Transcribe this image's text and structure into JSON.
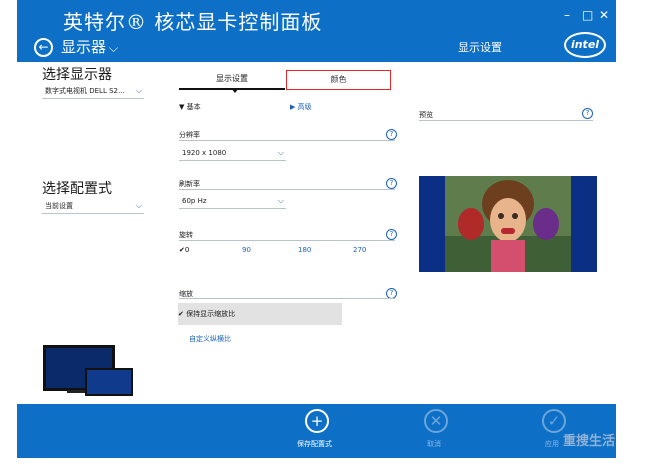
{
  "app": {
    "title": "英特尔® 核芯显卡控制面板",
    "section": "显示器",
    "breadcrumb": "显示设置",
    "logo": "intel",
    "window_controls": [
      "–",
      "□",
      "✕"
    ]
  },
  "left": {
    "select_display_heading": "选择显示器",
    "display_value": "数字式电视机 DELL S2…",
    "select_profile_heading": "选择配置式",
    "profile_value": "当前设置"
  },
  "tabs": [
    "显示设置",
    "颜色"
  ],
  "toggles": {
    "basic": "基本",
    "advanced": "高级"
  },
  "fields": {
    "resolution_label": "分辨率",
    "resolution_value": "1920 x 1080",
    "refresh_label": "刷新率",
    "refresh_value": "60p Hz",
    "rotation_label": "旋转",
    "rotation_options": [
      "0",
      "90",
      "180",
      "270"
    ],
    "rotation_selected": "0",
    "scaling_label": "缩放",
    "scaling_option": "保持显示缩放比",
    "custom_ratio_link": "自定义纵横比"
  },
  "preview": {
    "label": "预览"
  },
  "bottom": {
    "save_label": "保存配置式",
    "cancel_label": "取消",
    "apply_label": "应用"
  },
  "watermark": "重搜生活",
  "colors": {
    "accent": "#0d6fc6",
    "highlight_border": "#e02a2a",
    "link": "#1a62b8"
  }
}
